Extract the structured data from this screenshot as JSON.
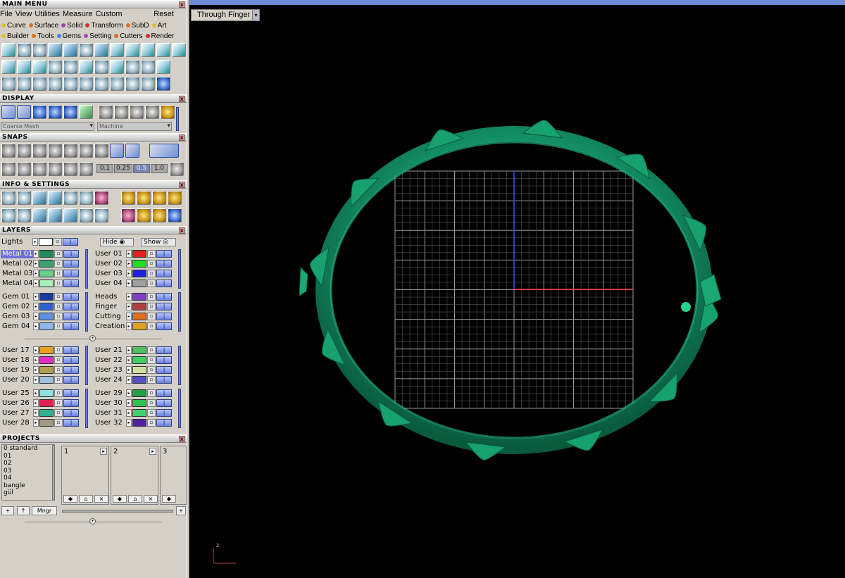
{
  "panels": {
    "main_menu": "MAIN MENU",
    "display": "DISPLAY",
    "snaps": "SNAPS",
    "info_settings": "INFO & SETTINGS",
    "layers": "LAYERS",
    "projects": "PROJECTS"
  },
  "menubar": {
    "items": [
      "File",
      "View",
      "Utilities",
      "Measure",
      "Custom"
    ],
    "reset": "Reset"
  },
  "categories": {
    "row1": [
      {
        "label": "Curve",
        "color": "#e0c030"
      },
      {
        "label": "Surface",
        "color": "#e07020"
      },
      {
        "label": "Solid",
        "color": "#b040c0"
      },
      {
        "label": "Transform",
        "color": "#d03030"
      },
      {
        "label": "SubD",
        "color": "#e07020"
      },
      {
        "label": "Art",
        "color": "#e0c030"
      }
    ],
    "row2": [
      {
        "label": "Builder",
        "color": "#e0c030"
      },
      {
        "label": "Tools",
        "color": "#e07020"
      },
      {
        "label": "Gems",
        "color": "#4080e0"
      },
      {
        "label": "Setting",
        "color": "#b040c0"
      },
      {
        "label": "Cutters",
        "color": "#e07020"
      },
      {
        "label": "Render",
        "color": "#d03030"
      }
    ]
  },
  "display": {
    "mesh_select": "Coarse Mesh",
    "material_select": "Machine"
  },
  "snaps": {
    "values": [
      "0.1",
      "0.25",
      "0.5",
      "1.0"
    ]
  },
  "layers": {
    "lights_label": "Lights",
    "hide_label": "Hide",
    "show_label": "Show",
    "left_groups": [
      [
        {
          "name": "Metal 01",
          "color": "#1f8a5a",
          "selected": true
        },
        {
          "name": "Metal 02",
          "color": "#3aa070"
        },
        {
          "name": "Metal 03",
          "color": "#6ad08a"
        },
        {
          "name": "Metal 04",
          "color": "#a8f0b8"
        }
      ],
      [
        {
          "name": "Gem 01",
          "color": "#1a3aa0"
        },
        {
          "name": "Gem 02",
          "color": "#3060d0"
        },
        {
          "name": "Gem 03",
          "color": "#6090e0"
        },
        {
          "name": "Gem 04",
          "color": "#90b8f0"
        }
      ],
      [
        {
          "name": "User 17",
          "color": "#e8a020"
        },
        {
          "name": "User 18",
          "color": "#e030c0"
        },
        {
          "name": "User 19",
          "color": "#b0a050"
        },
        {
          "name": "User 20",
          "color": "#a0c0e0"
        }
      ],
      [
        {
          "name": "User 25",
          "color": "#90e0e0"
        },
        {
          "name": "User 26",
          "color": "#e02050"
        },
        {
          "name": "User 27",
          "color": "#30b090"
        },
        {
          "name": "User 28",
          "color": "#a09880"
        }
      ]
    ],
    "right_groups": [
      [
        {
          "name": "User 01",
          "color": "#e02020"
        },
        {
          "name": "User 02",
          "color": "#20e020"
        },
        {
          "name": "User 03",
          "color": "#2020e0"
        },
        {
          "name": "User 04",
          "color": "#a0a0a0"
        }
      ],
      [
        {
          "name": "Heads",
          "color": "#8040c0"
        },
        {
          "name": "Finger",
          "color": "#b04040"
        },
        {
          "name": "Cutting",
          "color": "#e07020"
        },
        {
          "name": "Creation",
          "color": "#e0a020"
        }
      ],
      [
        {
          "name": "User 21",
          "color": "#50c060"
        },
        {
          "name": "User 22",
          "color": "#40d060"
        },
        {
          "name": "User 23",
          "color": "#d0e0a0"
        },
        {
          "name": "User 24",
          "color": "#5050c0"
        }
      ],
      [
        {
          "name": "User 29",
          "color": "#20a040"
        },
        {
          "name": "User 30",
          "color": "#30c050"
        },
        {
          "name": "User 31",
          "color": "#40d070"
        },
        {
          "name": "User 32",
          "color": "#5020a0"
        }
      ]
    ]
  },
  "projects": {
    "list": [
      "0 standard",
      "01",
      "02",
      "03",
      "04",
      "bangle",
      "gül"
    ],
    "slots": [
      "1",
      "2",
      "3"
    ],
    "mngr": "Mngr"
  },
  "viewport": {
    "command_tab": "Through Finger",
    "axis_label": "z"
  }
}
